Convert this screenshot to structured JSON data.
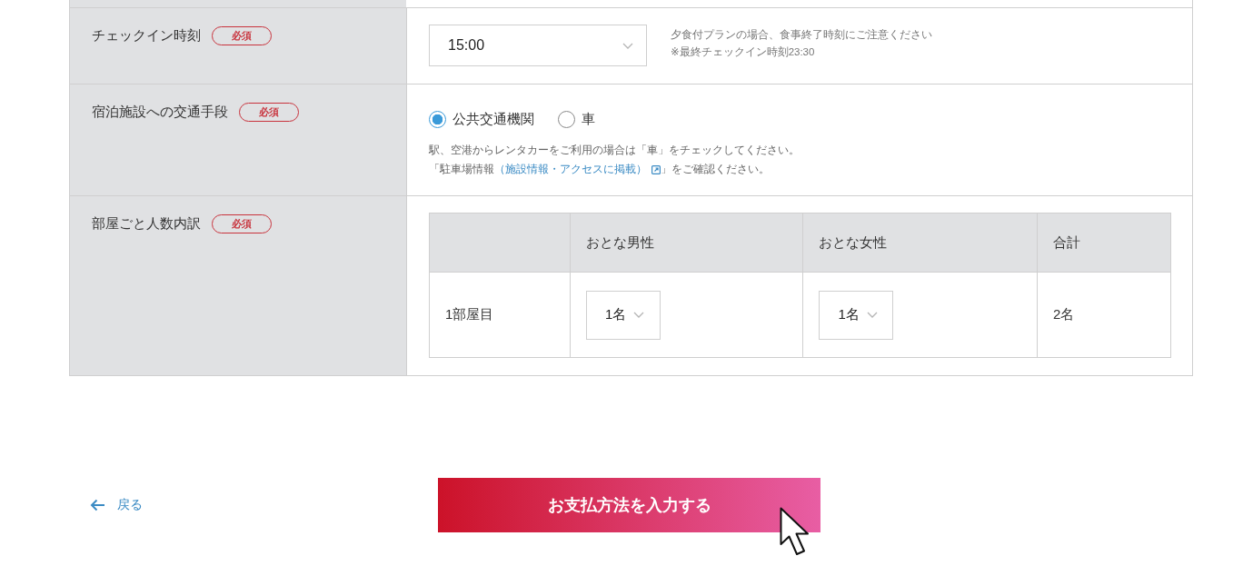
{
  "form": {
    "rows": [
      {
        "label": "チェックイン時刻",
        "badge": "必須",
        "kind": "select",
        "value": "15:00",
        "notes": [
          {
            "kind": "plain",
            "text": "夕食付プランの場合、食事終了時刻にご注意ください"
          },
          {
            "kind": "plain",
            "text": "※最終チェックイン時刻23:30"
          }
        ]
      },
      {
        "label": "宿泊施設への交通手段",
        "badge": "必須",
        "kind": "radio",
        "options": [
          {
            "label": "公共交通機関",
            "selected": true
          },
          {
            "label": "車",
            "selected": false
          }
        ],
        "notes": [
          {
            "kind": "plain",
            "text": "駅、空港からレンタカーをご利用の場合は「車」をチェックしてください。"
          },
          {
            "kind": "with_link",
            "before": "「駐車場情報",
            "link": "（施設情報・アクセスに掲載）",
            "after": "」をご確認ください。"
          }
        ]
      },
      {
        "label": "部屋ごと人数内訳",
        "badge": "必須",
        "kind": "room_table",
        "columns": [
          "",
          "おとな男性",
          "おとな女性",
          "合計"
        ],
        "rows": [
          {
            "cells": [
              {
                "kind": "text",
                "value": "1部屋目"
              },
              {
                "kind": "select",
                "value": "1名"
              },
              {
                "kind": "select",
                "value": "1名"
              },
              {
                "kind": "text",
                "value": "2名"
              }
            ]
          }
        ]
      }
    ]
  },
  "footer": {
    "back_link": "戻る",
    "submit_button": "お支払方法を入力する"
  }
}
